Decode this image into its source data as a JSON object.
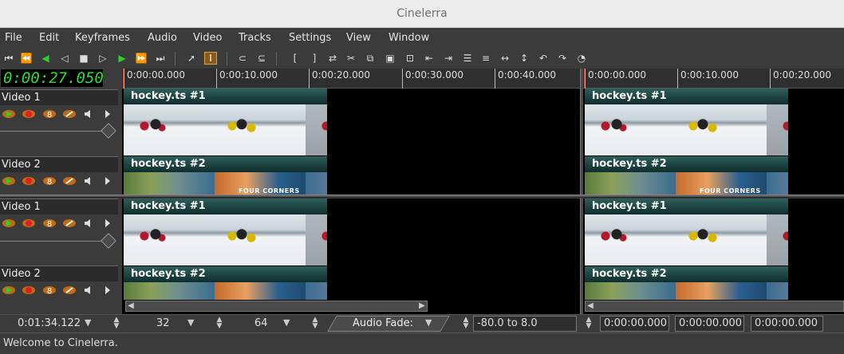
{
  "window": {
    "title": "Cinelerra"
  },
  "menu": [
    "File",
    "Edit",
    "Keyframes",
    "Audio",
    "Video",
    "Tracks",
    "Settings",
    "View",
    "Window"
  ],
  "transport_icons": [
    "rewind-to-start-icon",
    "fast-reverse-icon",
    "reverse-play-icon",
    "frame-reverse-icon",
    "stop-icon",
    "frame-forward-icon",
    "play-icon",
    "fast-forward-icon",
    "forward-to-end-icon"
  ],
  "edit_tools": [
    "arrow-tool-icon",
    "ibeam-tool-icon",
    "label-icon",
    "label-to-icon",
    "in-point-icon",
    "out-point-icon",
    "splice-icon",
    "cut-icon",
    "copy-icon",
    "paste-icon",
    "overwrite-icon",
    "previous-label-icon",
    "next-label-icon",
    "fit-selection-icon",
    "fit-autos-icon",
    "toggle-label-icon",
    "cut-undo-icon",
    "undo-icon",
    "redo-icon",
    "clock-icon"
  ],
  "clock": "0:00:27.050",
  "ruler_left": [
    "0:00:00.000",
    "0:00:10.000",
    "0:00:20.000",
    "0:00:30.000",
    "0:00:40.000"
  ],
  "ruler_right": [
    "0:00:00.000",
    "0:00:10.000",
    "0:00:20.000"
  ],
  "tracks": [
    {
      "title": "Video 1",
      "edit": "hockey.ts #1"
    },
    {
      "title": "Video 2",
      "edit": "hockey.ts #2"
    },
    {
      "title": "Video 1",
      "edit": "hockey.ts #1"
    },
    {
      "title": "Video 2",
      "edit": "hockey.ts #2"
    }
  ],
  "thumb_overlay_text": "FOUR CORNERS",
  "bottom": {
    "duration": "0:01:34.122",
    "zoom_samples": "32",
    "zoom_amp": "64",
    "audio_fade_label": "Audio Fade:",
    "fade_range": "-80.0 to 8.0",
    "sel_start": "0:00:00.000",
    "sel_length": "0:00:00.000",
    "sel_end": "0:00:00.000"
  },
  "status": "Welcome to Cinelerra."
}
